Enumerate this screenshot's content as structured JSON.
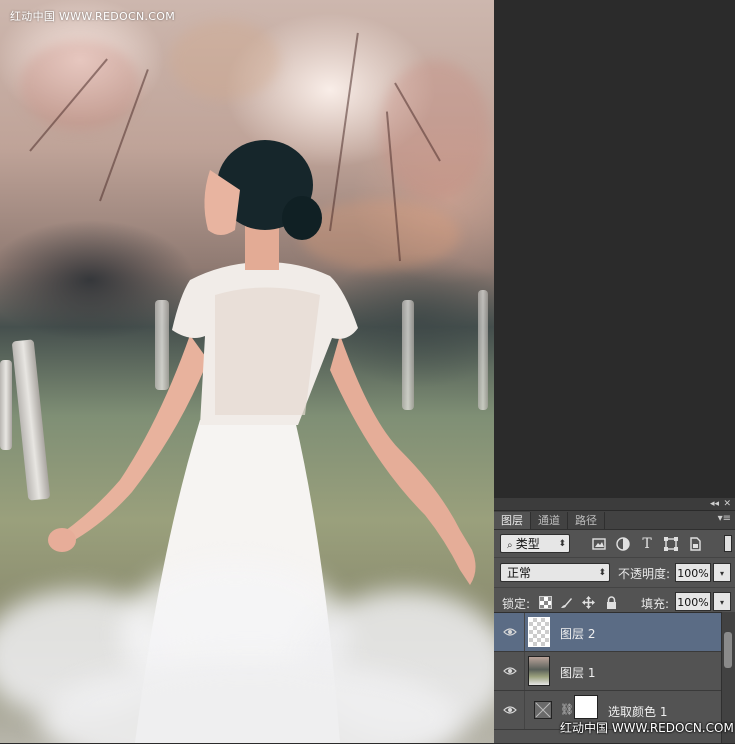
{
  "watermark_top": "红动中国 WWW.REDOCN.COM",
  "watermark_bottom": "红动中国 WWW.REDOCN.COM",
  "photo": {
    "subject": "woman-in-white-dress"
  },
  "panel": {
    "tabs": [
      {
        "label": "图层",
        "active": true
      },
      {
        "label": "通道",
        "active": false
      },
      {
        "label": "路径",
        "active": false
      }
    ],
    "filter": {
      "kind_label": "类型",
      "icons": [
        "image-filter-icon",
        "adjustment-filter-icon",
        "type-filter-icon",
        "shape-filter-icon",
        "smart-object-filter-icon"
      ]
    },
    "blend_mode": "正常",
    "opacity_label": "不透明度:",
    "opacity_value": "100%",
    "lock_label": "锁定:",
    "fill_label": "填充:",
    "fill_value": "100%",
    "layers": [
      {
        "name": "图层 2",
        "selected": true,
        "visible": true,
        "thumb": "transparent"
      },
      {
        "name": "图层 1",
        "selected": false,
        "visible": true,
        "thumb": "photo"
      },
      {
        "name": "选取颜色 1",
        "selected": false,
        "visible": true,
        "thumb": "adjustment"
      }
    ]
  },
  "colors": {
    "panel_bg": "#535353",
    "selected_layer": "#5b6c85",
    "workspace_bg": "#2b2b2b"
  }
}
